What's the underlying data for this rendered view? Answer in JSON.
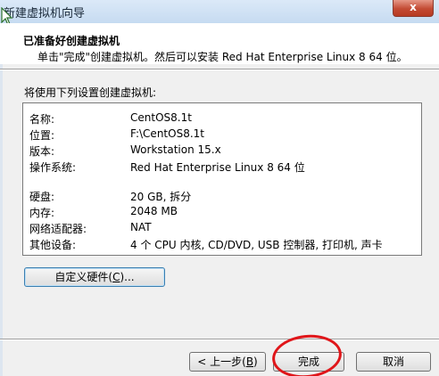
{
  "window": {
    "title": "新建虚拟机向导",
    "close_glyph": "x"
  },
  "header": {
    "title": "已准备好创建虚拟机",
    "subtitle": "单击\"完成\"创建虚拟机。然后可以安装 Red Hat Enterprise Linux 8 64 位。"
  },
  "summary": {
    "label": "将使用下列设置创建虚拟机:",
    "rows": [
      {
        "key": "名称:",
        "value": "CentOS8.1t"
      },
      {
        "key": "位置:",
        "value": "F:\\CentOS8.1t"
      },
      {
        "key": "版本:",
        "value": "Workstation 15.x"
      },
      {
        "key": "操作系统:",
        "value": "Red Hat Enterprise Linux 8 64 位"
      },
      {
        "key": "硬盘:",
        "value": "20 GB, 拆分"
      },
      {
        "key": "内存:",
        "value": "2048 MB"
      },
      {
        "key": "网络适配器:",
        "value": "NAT"
      },
      {
        "key": "其他设备:",
        "value": "4 个 CPU 内核, CD/DVD, USB 控制器, 打印机, 声卡"
      }
    ]
  },
  "buttons": {
    "customize": {
      "text": "自定义硬件(",
      "mnemonic": "C",
      "suffix": ")..."
    },
    "back": {
      "text": "< 上一步(",
      "mnemonic": "B",
      "suffix": ")"
    },
    "finish": "完成",
    "cancel": "取消"
  },
  "annotation": {
    "color": "#e0161a",
    "shape": "hand-drawn-ellipse"
  }
}
